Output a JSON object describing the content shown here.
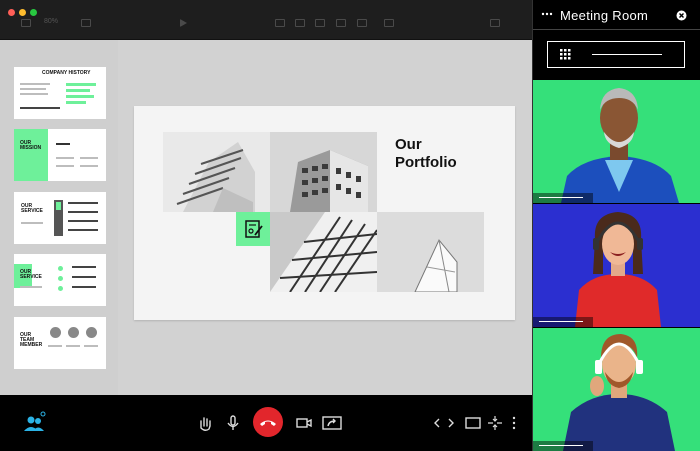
{
  "window": {
    "zoom": "80%"
  },
  "slide": {
    "title_line1": "Our",
    "title_line2": "Portfolio"
  },
  "thumbnails": [
    {
      "title": "COMPANY HISTORY"
    },
    {
      "title": "OUR MISSION"
    },
    {
      "title": "OUR SERVICE"
    },
    {
      "title": "OUR SERVICE"
    },
    {
      "title": "OUR TEAM MEMBER"
    }
  ],
  "meeting": {
    "title": "Meeting Room"
  },
  "participants": [
    {
      "id": "p1",
      "bg": "#35e07a"
    },
    {
      "id": "p2",
      "bg": "#2b2fd0"
    },
    {
      "id": "p3",
      "bg": "#35e07a"
    }
  ],
  "colors": {
    "accent": "#6ef09a",
    "hangup": "#e2262c",
    "people_icon": "#2bb3e6"
  }
}
